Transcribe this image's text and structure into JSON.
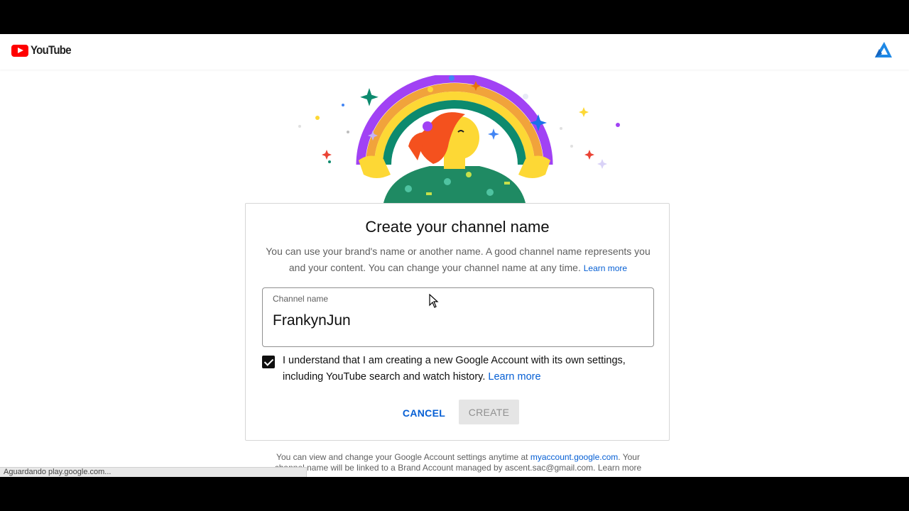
{
  "header": {
    "logo_text": "YouTube",
    "logo_icon": "youtube-play-icon",
    "account_icon": "channel-badge-icon"
  },
  "illustration": {
    "description_icon": "rainbow-person-illustration"
  },
  "card": {
    "title": "Create your channel name",
    "description": "You can use your brand's name or another name. A good channel name represents you and your content. You can change your channel name at any time.",
    "description_learn_more": "Learn more",
    "field_label": "Channel name",
    "field_value": "FrankynJun",
    "consent_checked": true,
    "consent_text": "I understand that I am creating a new Google Account with its own settings, including YouTube search and watch history.",
    "consent_learn_more": "Learn more",
    "cancel_label": "CANCEL",
    "create_label": "CREATE"
  },
  "footer": {
    "text_part1": "You can view and change your Google Account settings anytime at",
    "link": "myaccount.google.com",
    "text_part2": ". Your channel name will be linked to a Brand Account managed by ascent.sac@gmail.com.",
    "learn_more": "Learn more"
  },
  "status": {
    "text": "Aguardando play.google.com..."
  },
  "colors": {
    "accent": "#065fd4",
    "youtube_red": "#ff0000",
    "disabled_bg": "#e5e5e5"
  }
}
